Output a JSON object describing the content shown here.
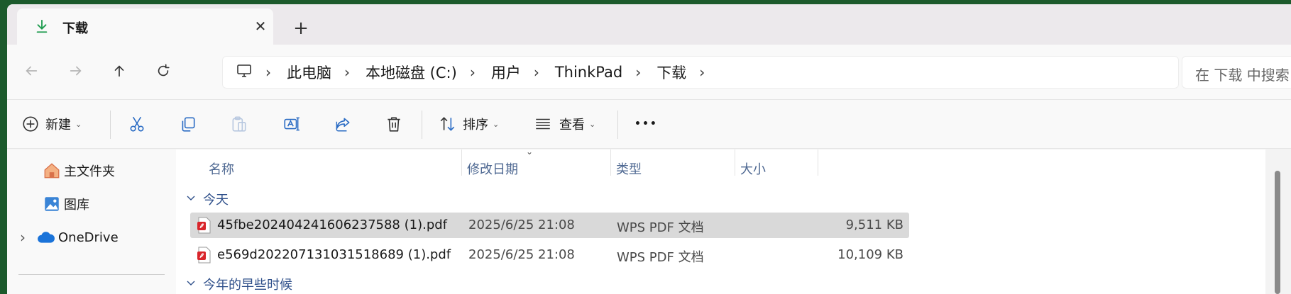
{
  "tab": {
    "title": "下载",
    "close_glyph": "✕",
    "new_tab_glyph": "+"
  },
  "breadcrumbs": [
    "此电脑",
    "本地磁盘 (C:)",
    "用户",
    "ThinkPad",
    "下载"
  ],
  "breadcrumb_separator": "›",
  "search": {
    "placeholder": "在 下载 中搜索"
  },
  "toolbar": {
    "new_label": "新建",
    "sort_label": "排序",
    "view_label": "查看",
    "more_glyph": "•••",
    "caret": "⌄"
  },
  "sidebar": {
    "items": [
      {
        "label": "主文件夹",
        "icon": "home-icon"
      },
      {
        "label": "图库",
        "icon": "gallery-icon"
      },
      {
        "label": "OneDrive",
        "icon": "cloud-icon",
        "expand_glyph": "›"
      }
    ]
  },
  "columns": {
    "name": "名称",
    "modified": "修改日期",
    "type": "类型",
    "size": "大小"
  },
  "groups": [
    {
      "label": "今天",
      "files": [
        {
          "name": "45fbe202404241606237588 (1).pdf",
          "modified": "2025/6/25 21:08",
          "type": "WPS PDF 文档",
          "size": "9,511 KB",
          "selected": true
        },
        {
          "name": "e569d202207131031518689 (1).pdf",
          "modified": "2025/6/25 21:08",
          "type": "WPS PDF 文档",
          "size": "10,109 KB",
          "selected": false
        }
      ]
    },
    {
      "label": "今年的早些时候",
      "files": []
    }
  ],
  "colors": {
    "accent_green": "#1f9c4f",
    "pdf_red": "#d9252b",
    "header_text": "#4d6791",
    "selection": "#d9d9d9",
    "onedrive_blue": "#1a73d9"
  }
}
